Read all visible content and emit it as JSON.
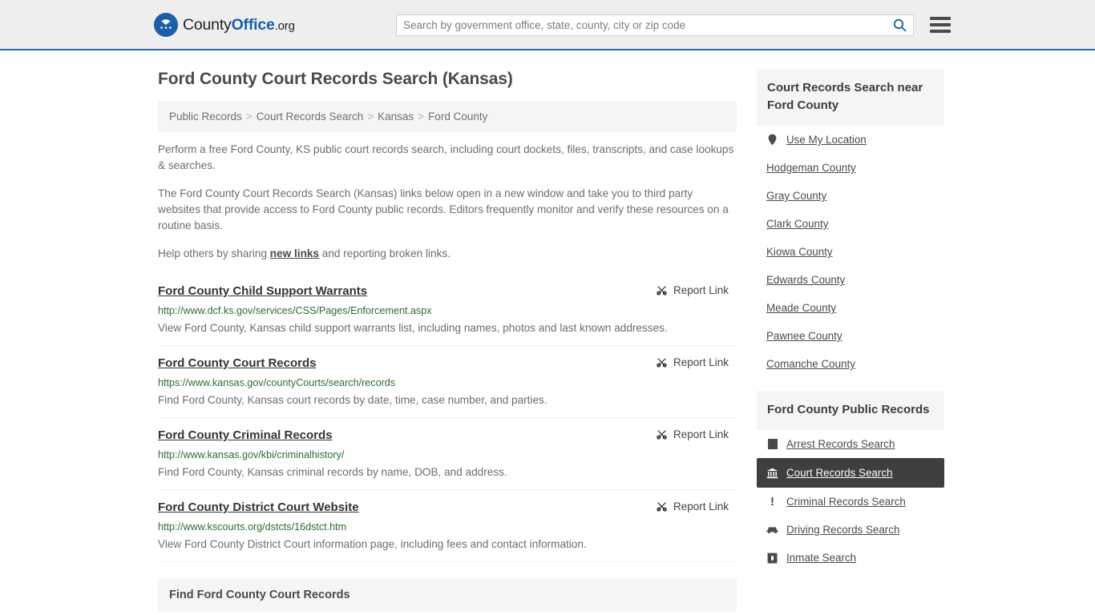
{
  "header": {
    "brand": {
      "part1": "County",
      "part2": "Office",
      "part3": ".org",
      "logo_icon": "eagle-stars-logo"
    },
    "search": {
      "placeholder": "Search by government office, state, county, city or zip code",
      "value": "",
      "search_icon": "search-icon"
    },
    "menu_icon": "hamburger-menu-icon"
  },
  "page": {
    "title": "Ford County Court Records Search (Kansas)",
    "breadcrumb": [
      {
        "label": "Public Records"
      },
      {
        "label": "Court Records Search"
      },
      {
        "label": "Kansas"
      },
      {
        "label": "Ford County"
      }
    ],
    "breadcrumb_separator": ">",
    "intro": [
      "Perform a free Ford County, KS public court records search, including court dockets, files, transcripts, and case lookups & searches.",
      "The Ford County Court Records Search (Kansas) links below open in a new window and take you to third party websites that provide access to Ford County public records. Editors frequently monitor and verify these resources on a routine basis."
    ],
    "help_prefix": "Help others by sharing ",
    "help_link": "new links",
    "help_suffix": " and reporting broken links."
  },
  "results": {
    "report_label": "Report Link",
    "report_icon": "broken-link-icon",
    "items": [
      {
        "title": "Ford County Child Support Warrants",
        "url": "http://www.dcf.ks.gov/services/CSS/Pages/Enforcement.aspx",
        "description": "View Ford County, Kansas child support warrants list, including names, photos and last known addresses."
      },
      {
        "title": "Ford County Court Records",
        "url": "https://www.kansas.gov/countyCourts/search/records",
        "description": "Find Ford County, Kansas court records by date, time, case number, and parties."
      },
      {
        "title": "Ford County Criminal Records",
        "url": "http://www.kansas.gov/kbi/criminalhistory/",
        "description": "Find Ford County, Kansas criminal records by name, DOB, and address."
      },
      {
        "title": "Ford County District Court Website",
        "url": "http://www.kscourts.org/dstcts/16dstct.htm",
        "description": "View Ford County District Court information page, including fees and contact information."
      }
    ]
  },
  "find_section": {
    "title": "Find Ford County Court Records"
  },
  "sidebar": {
    "nearby": {
      "heading": "Court Records Search near Ford County",
      "items": [
        {
          "label": "Use My Location",
          "icon": "map-pin-icon"
        },
        {
          "label": "Hodgeman County",
          "icon": ""
        },
        {
          "label": "Gray County",
          "icon": ""
        },
        {
          "label": "Clark County",
          "icon": ""
        },
        {
          "label": "Kiowa County",
          "icon": ""
        },
        {
          "label": "Edwards County",
          "icon": ""
        },
        {
          "label": "Meade County",
          "icon": ""
        },
        {
          "label": "Pawnee County",
          "icon": ""
        },
        {
          "label": "Comanche County",
          "icon": ""
        }
      ]
    },
    "public_records": {
      "heading": "Ford County Public Records",
      "items": [
        {
          "label": "Arrest Records Search",
          "icon": "book-icon",
          "active": false
        },
        {
          "label": "Court Records Search",
          "icon": "courthouse-icon",
          "active": true
        },
        {
          "label": "Criminal Records Search",
          "icon": "exclamation-icon",
          "active": false
        },
        {
          "label": "Driving Records Search",
          "icon": "car-icon",
          "active": false
        },
        {
          "label": "Inmate Search",
          "icon": "inmate-icon",
          "active": false
        }
      ]
    }
  }
}
